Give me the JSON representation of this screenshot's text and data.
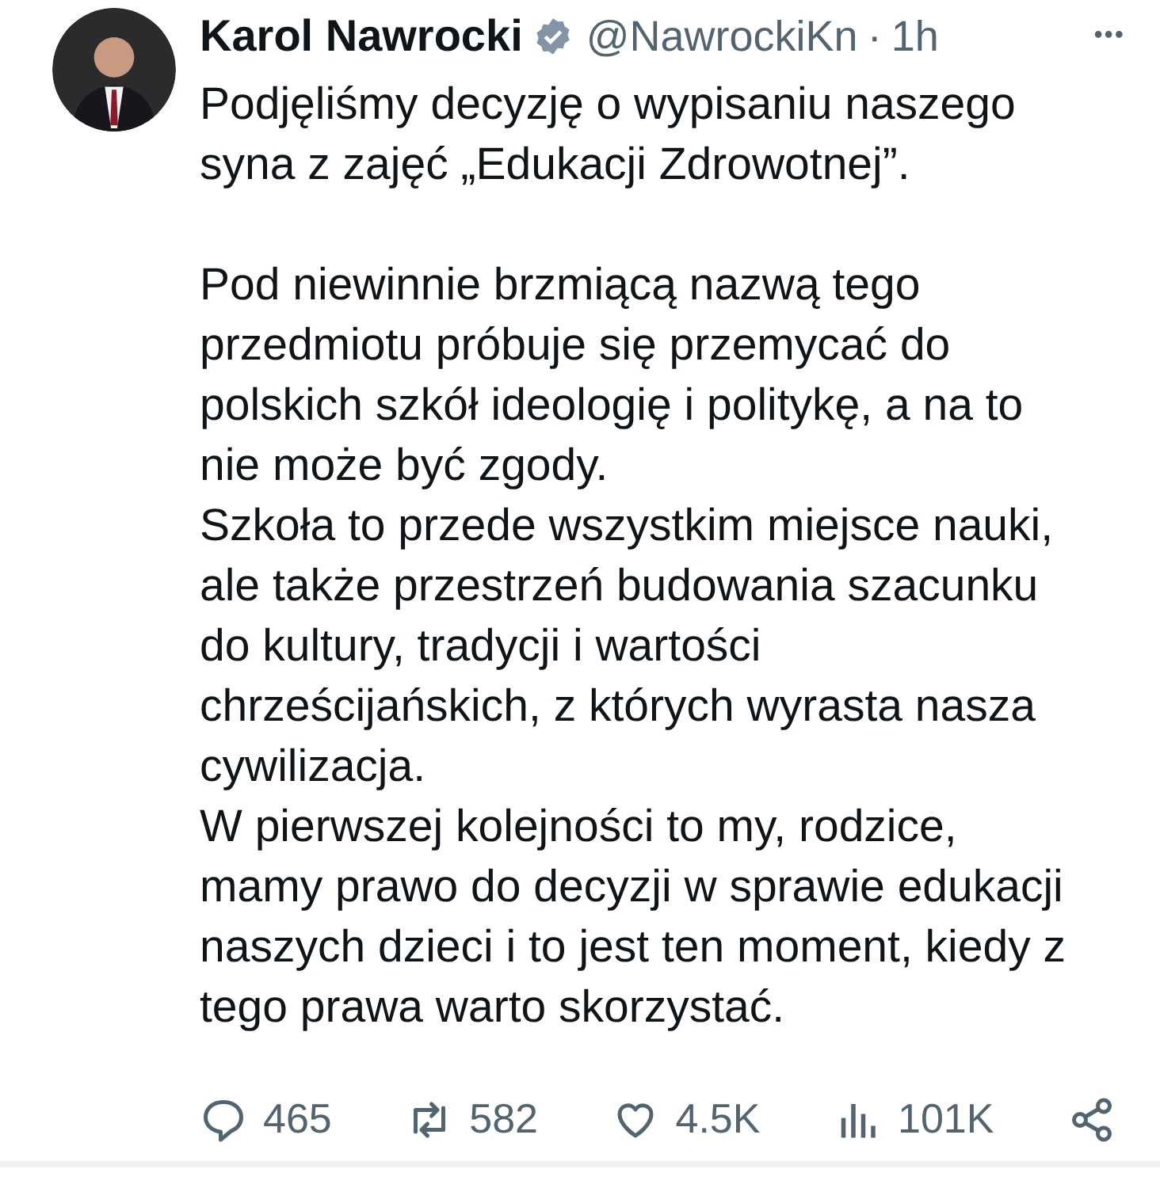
{
  "post": {
    "author": "Karol Nawrocki",
    "verified": true,
    "handle": "@NawrockiKn",
    "separator": "·",
    "time": "1h",
    "more": "•••",
    "paragraphs": [
      [
        "Podjęliśmy decyzję o wypisaniu naszego",
        "syna z zajęć „Edukacji Zdrowotnej”."
      ],
      [
        "Pod niewinnie brzmiącą nazwą tego",
        "przedmiotu próbuje się przemycać do",
        "polskich szkół ideologię i politykę, a na to",
        "nie może być zgody.",
        "Szkoła to przede wszystkim miejsce nauki,",
        "ale także przestrzeń budowania szacunku",
        "do kultury, tradycji i wartości",
        "chrześcijańskich, z których wyrasta nasza",
        "cywilizacja.",
        "W pierwszej kolejności to my, rodzice,",
        "mamy prawo do decyzji w sprawie edukacji",
        "naszych dzieci i to jest ten moment, kiedy z",
        "tego prawa warto skorzystać."
      ]
    ],
    "actions": [
      {
        "kind": "reply",
        "count": "465"
      },
      {
        "kind": "repost",
        "count": "582"
      },
      {
        "kind": "like",
        "count": "4.5K"
      },
      {
        "kind": "views",
        "count": "101K"
      },
      {
        "kind": "share"
      }
    ]
  }
}
